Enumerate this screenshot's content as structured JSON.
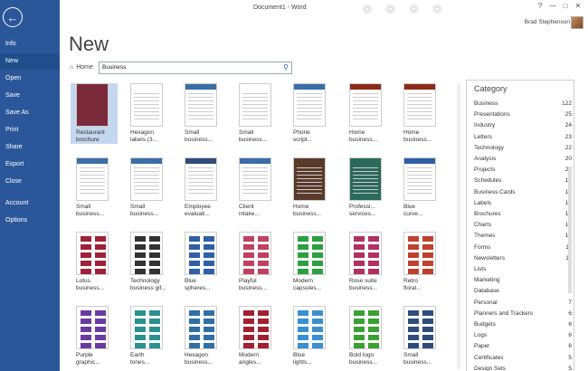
{
  "window": {
    "title": "Document1 - Word",
    "user": "Brad Stephenson"
  },
  "rail": {
    "items": [
      "Info",
      "New",
      "Open",
      "Save",
      "Save As",
      "Print",
      "Share",
      "Export",
      "Close",
      "Account",
      "Options"
    ],
    "active": "New"
  },
  "page": {
    "heading": "New",
    "home_label": "Home",
    "search_value": "Business"
  },
  "templates": [
    [
      "Restaurant brochure",
      "Hexagon labels (3...",
      "Small business...",
      "Small business...",
      "Phone script...",
      "Home business...",
      "Home business..."
    ],
    [
      "Small business...",
      "Small business...",
      "Employee evaluati...",
      "Client intake...",
      "Home business...",
      "Professi... services...",
      "Blue curve..."
    ],
    [
      "Lotus business...",
      "Technology business gif...",
      "Blue spheres...",
      "Playful business...",
      "Modern capsules...",
      "Rose suite business...",
      "Retro floral..."
    ],
    [
      "Purple graphic...",
      "Earth tones...",
      "Hexagon business...",
      "Modern angles...",
      "Blue lights...",
      "Bold logo business...",
      "Small business..."
    ]
  ],
  "category": {
    "title": "Category",
    "items": [
      {
        "name": "Business",
        "count": "122"
      },
      {
        "name": "Presentations",
        "count": "25"
      },
      {
        "name": "Industry",
        "count": "24"
      },
      {
        "name": "Letters",
        "count": "23"
      },
      {
        "name": "Technology",
        "count": "22"
      },
      {
        "name": "Analysis",
        "count": "20"
      },
      {
        "name": "Projects",
        "count": "20"
      },
      {
        "name": "Schedules",
        "count": "19"
      },
      {
        "name": "Business Cards",
        "count": "18"
      },
      {
        "name": "Labels",
        "count": "16"
      },
      {
        "name": "Brochures",
        "count": "12"
      },
      {
        "name": "Charts",
        "count": "12"
      },
      {
        "name": "Themes",
        "count": "12"
      },
      {
        "name": "Forms",
        "count": "11"
      },
      {
        "name": "Newsletters",
        "count": "11"
      },
      {
        "name": "Lists",
        "count": "9"
      },
      {
        "name": "Marketing",
        "count": "9"
      },
      {
        "name": "Database",
        "count": "8"
      },
      {
        "name": "Personal",
        "count": "7"
      },
      {
        "name": "Planners and Trackers",
        "count": "6"
      },
      {
        "name": "Budgets",
        "count": "6"
      },
      {
        "name": "Logs",
        "count": "6"
      },
      {
        "name": "Paper",
        "count": "6"
      },
      {
        "name": "Certificates",
        "count": "5"
      },
      {
        "name": "Design Sets",
        "count": "5"
      }
    ]
  },
  "colors": {
    "accent": "#2b579a",
    "selected": "#c5d7ee"
  }
}
